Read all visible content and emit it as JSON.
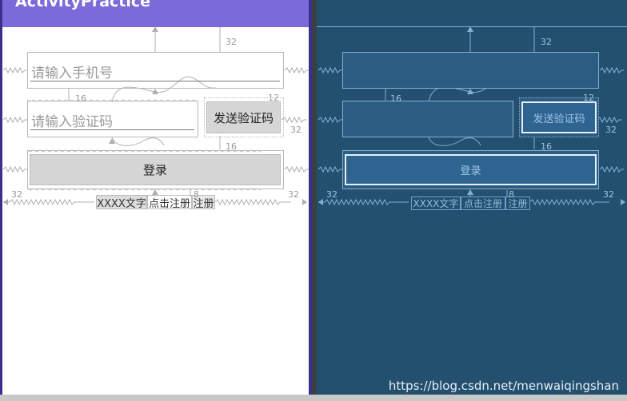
{
  "app": {
    "title": "ActivityPractice"
  },
  "form": {
    "phone_placeholder": "请输入手机号",
    "code_placeholder": "请输入验证码",
    "send_code_label": "发送验证码",
    "login_label": "登录"
  },
  "footer_row": {
    "text_1": "XXXX文字",
    "text_2": "点击注册",
    "text_3": "注册"
  },
  "constraints": {
    "top_margin": "32",
    "left_margin": "32",
    "right_margin": "32",
    "gap_16a": "16",
    "gap_16b": "16",
    "gap_12": "12",
    "gap_8": "8"
  },
  "watermark": "https://blog.csdn.net/menwaiqingshan",
  "colors": {
    "accent": "#7b6bd9",
    "blueprint_bg": "#24506f",
    "blueprint_line": "#7fb0d6"
  }
}
